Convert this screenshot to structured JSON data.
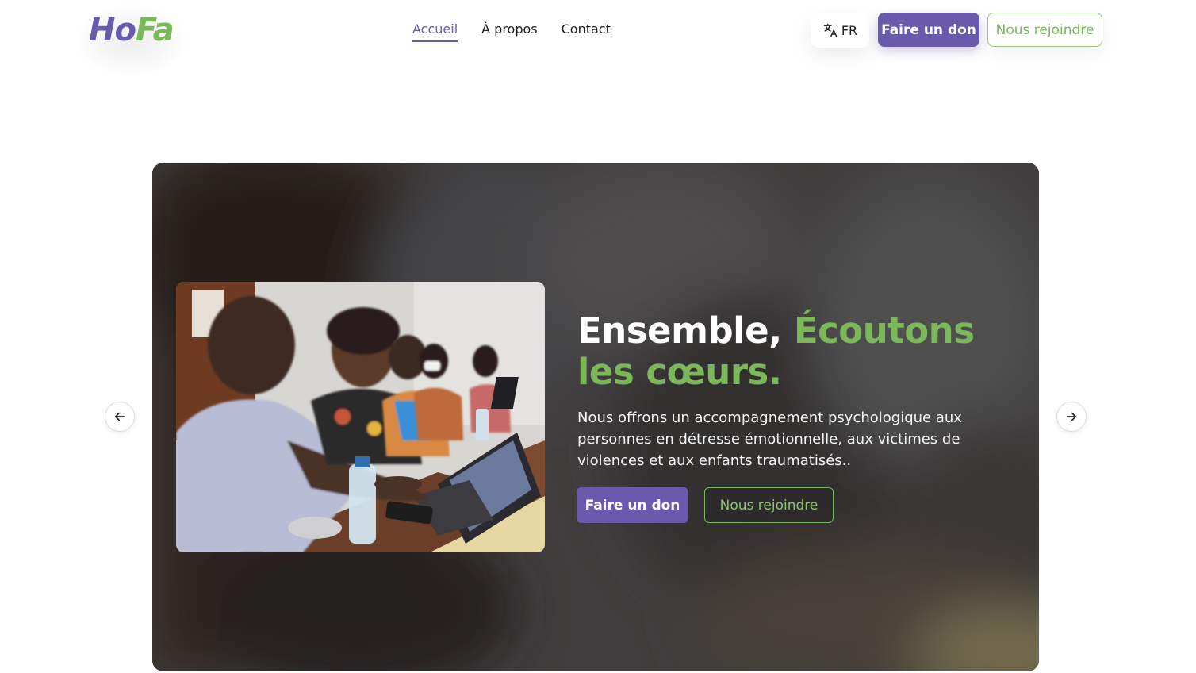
{
  "header": {
    "logo": {
      "part1": "Ho",
      "part2": "Fa"
    },
    "nav": [
      {
        "label": "Accueil",
        "active": true
      },
      {
        "label": "À propos",
        "active": false
      },
      {
        "label": "Contact",
        "active": false
      }
    ],
    "language": {
      "code": "FR",
      "icon": "translate-icon"
    },
    "donate_label": "Faire un don",
    "join_label": "Nous rejoindre"
  },
  "hero": {
    "title_white": "Ensemble, ",
    "title_green": "Écoutons les cœurs.",
    "subtitle": "Nous offrons un accompagnement psychologique aux personnes en détresse émotionnelle, aux victimes de violences et aux enfants traumatisés..",
    "donate_label": "Faire un don",
    "join_label": "Nous rejoindre",
    "prev_icon": "arrow-left-icon",
    "next_icon": "arrow-right-icon"
  },
  "colors": {
    "brand_purple": "#6a5aad",
    "brand_green": "#7ab85a",
    "text_dark": "#1e1e1e"
  }
}
